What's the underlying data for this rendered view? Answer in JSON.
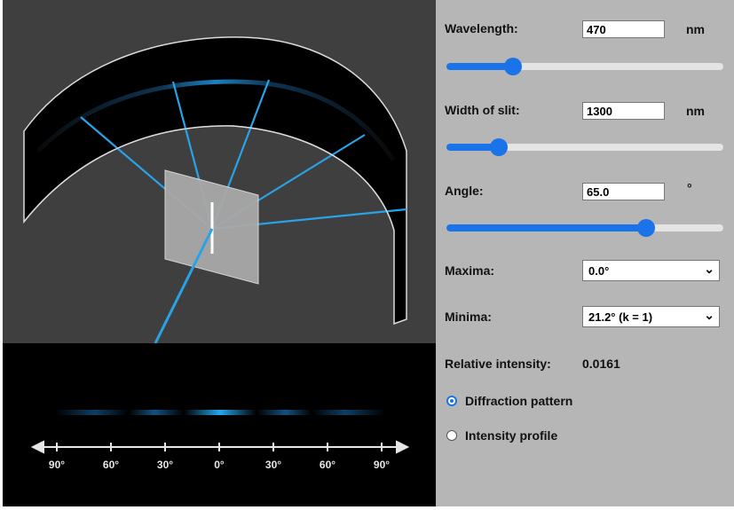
{
  "controls": {
    "wavelength": {
      "label": "Wavelength:",
      "value": "470",
      "unit": "nm",
      "slider_fraction": 0.24
    },
    "slit_width": {
      "label": "Width of slit:",
      "value": "1300",
      "unit": "nm",
      "slider_fraction": 0.19
    },
    "angle": {
      "label": "Angle:",
      "value": "65.0",
      "unit": "°",
      "slider_fraction": 0.72
    },
    "maxima": {
      "label": "Maxima:",
      "selected": "0.0°"
    },
    "minima": {
      "label": "Minima:",
      "selected": "21.2° (k = 1)"
    },
    "relative_intensity": {
      "label": "Relative intensity:",
      "value": "0.0161"
    },
    "display_mode": {
      "options": [
        {
          "label": "Diffraction pattern",
          "selected": true
        },
        {
          "label": "Intensity profile",
          "selected": false
        }
      ]
    }
  },
  "pattern_axis": {
    "tick_labels": [
      "90°",
      "60°",
      "30°",
      "0°",
      "30°",
      "60°",
      "90°"
    ]
  },
  "colors": {
    "accent": "#1a73e8",
    "light_beam": "#1ea0ea",
    "panel_bg": "#b6b6b6",
    "scene_bg": "#3f3f3f"
  },
  "icons": {
    "dropdown": "chevron-down-icon",
    "radio": "radio-button-icon"
  }
}
